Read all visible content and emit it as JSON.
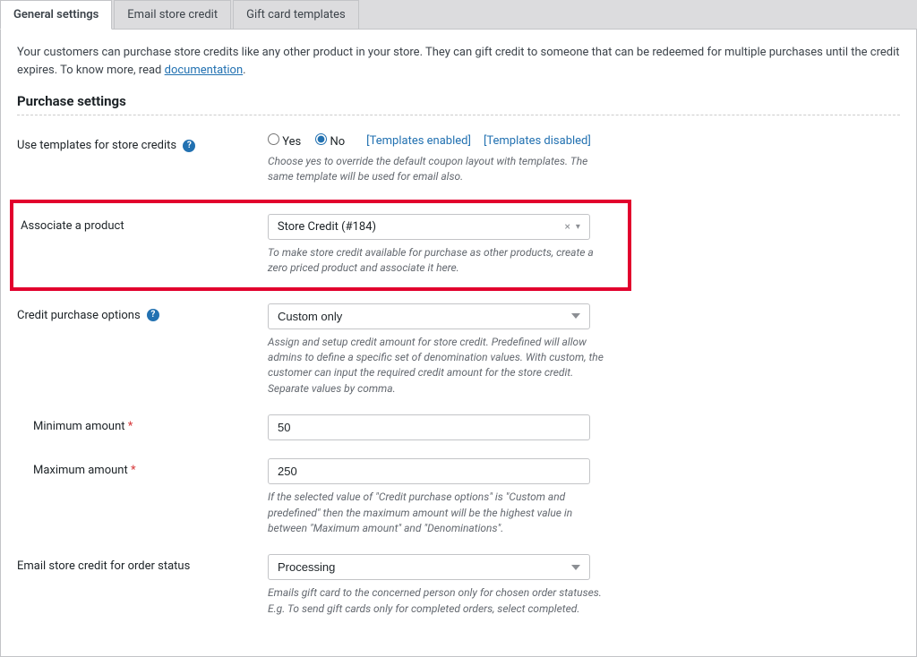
{
  "tabs": {
    "general": "General settings",
    "email": "Email store credit",
    "gift": "Gift card templates"
  },
  "intro": {
    "text_before": "Your customers can purchase store credits like any other product in your store. They can gift credit to someone that can be redeemed for multiple purchases until the credit expires. To know more, read ",
    "link": "documentation",
    "text_after": "."
  },
  "section_title": "Purchase settings",
  "use_templates": {
    "label": "Use templates for store credits",
    "yes": "Yes",
    "no": "No",
    "templates_enabled": "[Templates enabled]",
    "templates_disabled": "[Templates disabled]",
    "desc": "Choose yes to override the default coupon layout with templates. The same template will be used for email also."
  },
  "associate": {
    "label": "Associate a product",
    "value": "Store Credit (#184)",
    "desc": "To make store credit available for purchase as other products, create a zero priced product and associate it here."
  },
  "credit_options": {
    "label": "Credit purchase options",
    "value": "Custom only",
    "desc": "Assign and setup credit amount for store credit. Predefined will allow admins to define a specific set of denomination values. With custom, the customer can input the required credit amount for the store credit. Separate values by comma."
  },
  "min_amount": {
    "label": "Minimum amount",
    "value": "50"
  },
  "max_amount": {
    "label": "Maximum amount",
    "value": "250",
    "desc": "If the selected value of \"Credit purchase options\" is \"Custom and predefined\" then the maximum amount will be the highest value in between \"Maximum amount\" and \"Denominations\"."
  },
  "email_status": {
    "label": "Email store credit for order status",
    "value": "Processing",
    "desc": "Emails gift card to the concerned person only for chosen order statuses. E.g. To send gift cards only for completed orders, select completed."
  }
}
